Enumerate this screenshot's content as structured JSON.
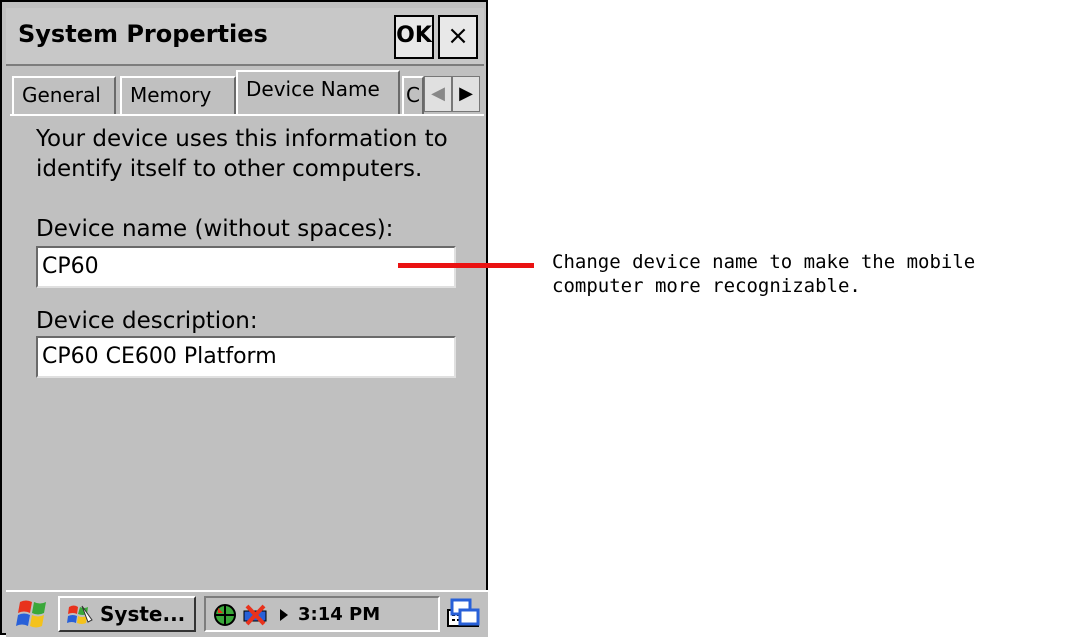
{
  "window": {
    "title": "System Properties",
    "ok_label": "OK",
    "close_label": "×"
  },
  "tabs": [
    {
      "label": "General"
    },
    {
      "label": "Memory"
    },
    {
      "label": "Device Name",
      "active": true
    },
    {
      "label": "C"
    }
  ],
  "content": {
    "info_text": "Your device uses this information to identify itself to other computers.",
    "name_label": "Device name (without spaces):",
    "name_value": "CP60",
    "desc_label": "Device description:",
    "desc_value": "CP60 CE600 Platform"
  },
  "taskbar": {
    "task_label": "Syste...",
    "clock": "3:14 PM"
  },
  "annotation": {
    "text": "Change device name to make the mobile computer more recognizable.",
    "pointer_color": "#ea1212"
  },
  "icons": [
    "start-icon",
    "system-icon",
    "network-icon",
    "battery-icon",
    "keyboard-icon",
    "window-switch-icon"
  ]
}
